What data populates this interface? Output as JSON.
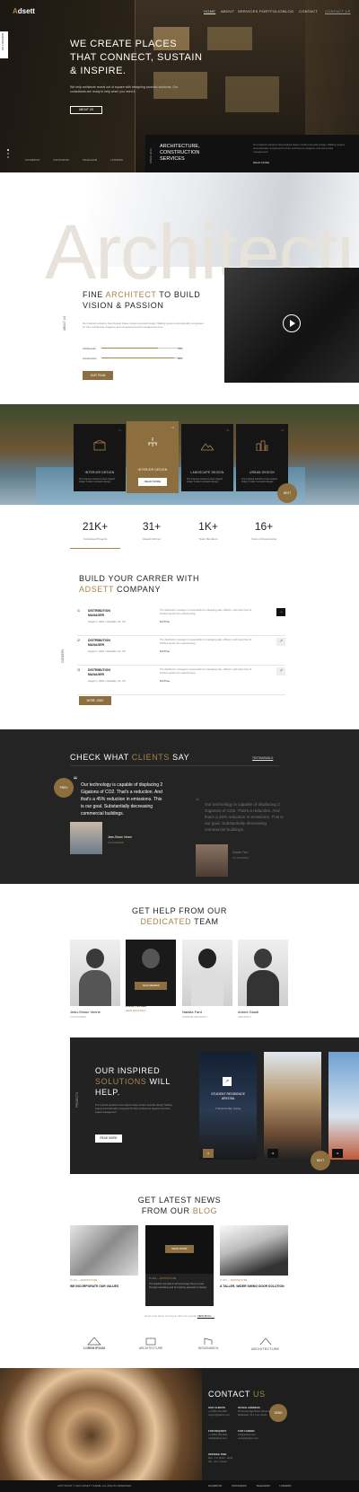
{
  "brand": {
    "first": "A",
    "rest": "dsett"
  },
  "nav": [
    "HOME",
    "ABOUT",
    "SERVICES",
    "PORTFOLIO",
    "BLOG",
    "CONTACT"
  ],
  "nav_cta": "CONTACT US",
  "hero": {
    "title_l1": "WE CREATE PLACES",
    "title_l2": "THAT CONNECT, SUSTAIN",
    "title_l3": "& INSPIRE.",
    "sub": "We help architects reveal out of square with designing acoustic solutions. Our consultants are ready to help when you need it.",
    "button": "ABOUT US",
    "side_tab": "CONTACT US",
    "social": [
      "FACEBOOK",
      "INSTAGRAM",
      "TELEGRAM",
      "LINKEDIN"
    ],
    "since": "SINCE 2016",
    "box_title_l1": "ARCHITECTURE,",
    "box_title_l2": "CONSTRUCTION",
    "box_title_l3": "SERVICES",
    "box_text": "Our inspired solutions have helped shape modern acoustic design. Making spaces internationally recognised for their architecture elegance and low-impact management.",
    "box_link": "READ MORE"
  },
  "about": {
    "big_word": "Architecture",
    "side_label": "ABOUT US",
    "title_a": "FINE ",
    "title_hl": "ARCHITECT",
    "title_b": " TO BUILD",
    "title_l2": "VISION & PASSION",
    "text": "Our inspired solutions have helped shape modern acoustic design. Making spaces internationally recognised for their architecture elegance and exceptional sound management here.",
    "skills": [
      {
        "name": "Architecture",
        "value": "70%",
        "pct": 0.7
      },
      {
        "name": "Construction",
        "value": "90%",
        "pct": 0.9
      }
    ],
    "button": "OUR TEAM"
  },
  "services": {
    "items": [
      {
        "num": "/ 1",
        "title": "INTERIOR DESIGN",
        "text": "Our inspired solutions have helped shape modern acoustic design."
      },
      {
        "num": "/ 2",
        "title": "INTERIOR DESIGN",
        "text": "READ MORE"
      },
      {
        "num": "/ 3",
        "title": "LANDSCAPE DESIGN",
        "text": "Our inspired solutions have helped shape modern acoustic design."
      },
      {
        "num": "/ 4",
        "title": "URBAN DESIGN",
        "text": "Our inspired solutions have helped shape modern acoustic design."
      }
    ],
    "circle": "NEXT"
  },
  "stats": [
    {
      "n": "21K+",
      "l": "Completed Projects"
    },
    {
      "n": "31+",
      "l": "Awards Winner"
    },
    {
      "n": "1K+",
      "l": "Team Members"
    },
    {
      "n": "16+",
      "l": "Years of Experiences"
    }
  ],
  "careers": {
    "side_label": "CAREERS",
    "title_l1": "BUILD YOUR CARRER WITH",
    "title_hl": "ADSETT",
    "title_l2": " COMPANY",
    "jobs": [
      {
        "num": "/1",
        "t1": "DISTRIBUTION",
        "t2": "MANAGER",
        "meta": "August 1, 2022  •  Vacaville, CA, US",
        "desc": "The distribution manager is responsible for managing safe, efficient, and timely flow of finished goods from warehousing.",
        "type": "Full Time",
        "arrow": "→"
      },
      {
        "num": "/2",
        "t1": "DISTRIBUTION",
        "t2": "MANAGER",
        "meta": "August 1, 2022  •  Vacaville, CA, US",
        "desc": "The distribution manager is responsible for managing safe, efficient, and timely flow of finished goods from warehousing.",
        "type": "Full Time",
        "arrow": "↗"
      },
      {
        "num": "/3",
        "t1": "DISTRIBUTION",
        "t2": "MANAGER",
        "meta": "August 1, 2022  •  Vacaville, CA, US",
        "desc": "The distribution manager is responsible for managing safe, efficient, and timely flow of finished goods from warehousing.",
        "type": "Full Time",
        "arrow": "↗"
      }
    ],
    "button": "MORE JOBS"
  },
  "testimonials": {
    "title_a": "CHECK WHAT ",
    "title_hl": "CLIENTS",
    "title_b": " SAY",
    "tag": "TESTIMONIALS",
    "prev": "PREV",
    "quote1": "Our technology is capable of displacing 2 Gigatons of CO2. That's a reduction. And that's a 45% reduction in emissions. This is our goal. Substantially decreasing commercial buildings.",
    "name1": "Jean-Simon Venne",
    "role1": "CO-FOUNDER",
    "quote2": "Our technology is capable of displacing 2 Gigatons of CO2. That's a reduction. And that's a 45% reduction in emissions. This is our goal. Substantially decreasing commercial buildings.",
    "name2": "Natalia Fard",
    "role2": "CO-FOUNDER"
  },
  "team": {
    "title_l1": "GET HELP FROM OUR",
    "title_hl": "DEDICATED",
    "title_l2": " TEAM",
    "members": [
      {
        "name": "Jean-Simon Venne",
        "role": "CO-FOUNDER"
      },
      {
        "name": "Zaha Ronald",
        "role": "HEAD ARCHITECT"
      },
      {
        "name": "Natalia Fard",
        "role": "INTERIOR ARCHITECT"
      },
      {
        "name": "Antoni Gaudi",
        "role": "ARCHITECT"
      }
    ],
    "overlay_btn": "TEAM MEMBER"
  },
  "projects": {
    "side_label": "PROJECTS",
    "title_l1": "OUR INSPIRED",
    "title_hl": "SOLUTIONS",
    "title_b": " WILL",
    "title_l3": "HELP.",
    "text": "Our inspired solutions have helped shape modern acoustic design. Making spaces internationally recognised for their architecture elegance and low-impact management.",
    "button": "READ MORE",
    "card_title_l1": "STUDENT RESIDENCE",
    "card_title_l2": "AREOSA",
    "card_loc": "17 Mnawna Way, Sydney",
    "nums": [
      "/1",
      "/2",
      "/3"
    ],
    "circle": "NEXT"
  },
  "news": {
    "title_l1": "GET LATEST NEWS",
    "title_l2a": "FROM OUR ",
    "title_hl": "BLOG",
    "posts": [
      {
        "date": "25 JAN",
        "cat": "ARCHITECTURE",
        "title": "WE INCORPORATE OUR VALUES",
        "text": ""
      },
      {
        "date": "25 JAN",
        "cat": "ARCHITECTURE",
        "title": "",
        "text": "Our inspired new idea it well encourage them to grow through networking and an inspiring approach to design."
      },
      {
        "date": "25 JAN",
        "cat": "ARCHITECTURE",
        "title": "A TALLER, WIDER SWING DOOR SOLUTION",
        "text": ""
      }
    ],
    "read_more": "READ MORE",
    "footer_note": "Great news about our blog & other into popular",
    "footer_link": "VIEW BLOG →",
    "logos": [
      "LOREM IPSUM",
      "ARCHITECTURE",
      "DESIGNARCH",
      "ARCHITECTURE"
    ]
  },
  "contact": {
    "title_a": "CONTACT ",
    "title_hl": "US",
    "circle": "SEND",
    "blocks": [
      {
        "label": "OUR CLIENTS",
        "value": "+1 (555) 123-4567\nsupport@adsett.com"
      },
      {
        "label": "OFFICE ADDRESS",
        "value": "50 Stonebridge Bristol Wedmore\nBridlesway, St.1 Lyric Studio"
      },
      {
        "label": "FOR REQUEST",
        "value": "+1 (555) 765-4321\nhello@adsett.com"
      },
      {
        "label": "FOR CAREER",
        "value": "info@adsett.com\ncareer@adsett.com"
      },
      {
        "label": "OPENING TIME",
        "value": "Mon - Fri: 09:00 - 18:00\nSat - Sun: Closed"
      }
    ]
  },
  "footer": {
    "copy": "COPYRIGHT © 2022 ADSETT THEME. ALL RIGHTS RESERVED.",
    "social": [
      "FACEBOOK",
      "INSTAGRAM",
      "TELEGRAM",
      "LINKEDIN"
    ]
  },
  "colors": {
    "accent": "#a7834b",
    "dark": "#222222"
  }
}
